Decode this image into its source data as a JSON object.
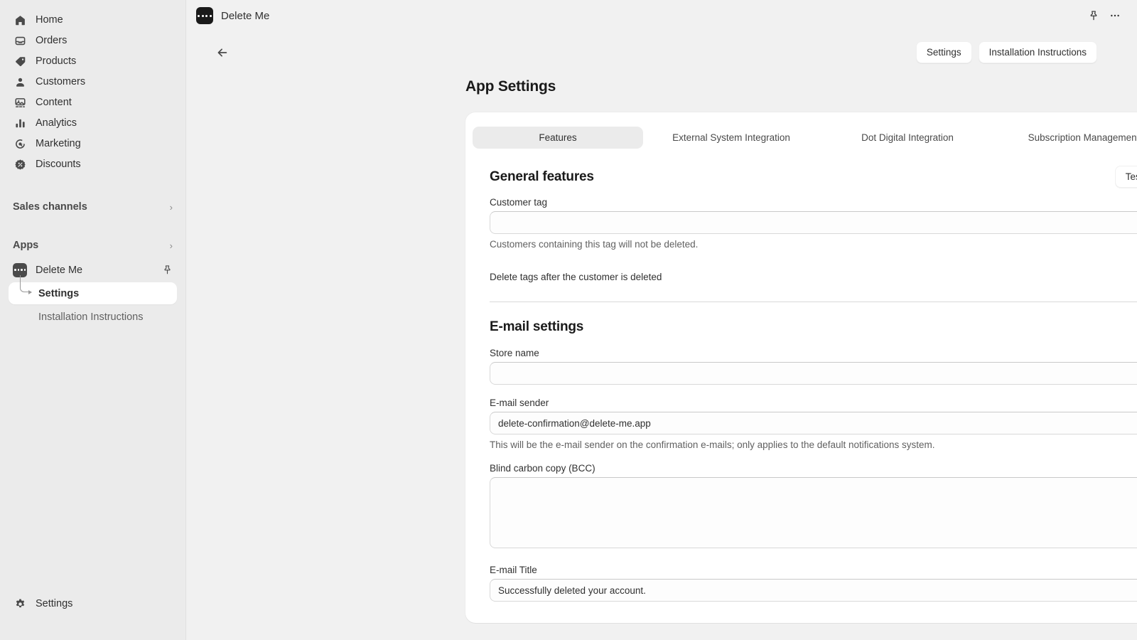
{
  "sidebar": {
    "items": [
      {
        "label": "Home",
        "icon": "home-icon"
      },
      {
        "label": "Orders",
        "icon": "orders-icon"
      },
      {
        "label": "Products",
        "icon": "products-tag-icon"
      },
      {
        "label": "Customers",
        "icon": "customers-person-icon"
      },
      {
        "label": "Content",
        "icon": "content-image-icon"
      },
      {
        "label": "Analytics",
        "icon": "analytics-bars-icon"
      },
      {
        "label": "Marketing",
        "icon": "marketing-target-icon"
      },
      {
        "label": "Discounts",
        "icon": "discounts-badge-icon"
      }
    ],
    "sales_channels": {
      "label": "Sales channels",
      "chevron": "›"
    },
    "apps": {
      "label": "Apps",
      "chevron": "›"
    },
    "app_entry": {
      "label": "Delete Me",
      "icon": "delete-me-app-icon",
      "pin": "pin-icon"
    },
    "sub_items": [
      {
        "label": "Settings",
        "active": true
      },
      {
        "label": "Installation Instructions",
        "active": false
      }
    ],
    "bottom": {
      "label": "Settings",
      "icon": "gear-icon"
    }
  },
  "topbar": {
    "app_title": "Delete Me",
    "pin_icon": "pin-icon",
    "more_icon": "more-horizontal-icon"
  },
  "actions": {
    "back_icon": "back-arrow-icon",
    "settings_label": "Settings",
    "installation_label": "Installation Instructions"
  },
  "page": {
    "title": "App Settings"
  },
  "tabs": [
    {
      "label": "Features",
      "active": true
    },
    {
      "label": "External System Integration",
      "active": false
    },
    {
      "label": "Dot Digital Integration",
      "active": false
    },
    {
      "label": "Subscription Management",
      "active": false
    }
  ],
  "general_features": {
    "title": "General features",
    "test_email_button": "Test e-mail",
    "customer_tag": {
      "label": "Customer tag",
      "value": "",
      "placeholder": "",
      "help": "Customers containing this tag will not be deleted."
    },
    "delete_tags_toggle": {
      "label": "Delete tags after the customer is deleted",
      "state": "on",
      "on_color": "#13a873",
      "track_color": "#c7ecdc"
    }
  },
  "email_settings": {
    "title": "E-mail settings",
    "store_name": {
      "label": "Store name",
      "value": "",
      "placeholder": ""
    },
    "email_sender": {
      "label": "E-mail sender",
      "value": "delete-confirmation@delete-me.app",
      "placeholder": "",
      "help": "This will be the e-mail sender on the confirmation e-mails; only applies to the default notifications system."
    },
    "bcc": {
      "label": "Blind carbon copy (BCC)",
      "value": "",
      "placeholder": ""
    },
    "email_title": {
      "label": "E-mail Title",
      "value": "Successfully deleted your account.",
      "placeholder": ""
    }
  }
}
